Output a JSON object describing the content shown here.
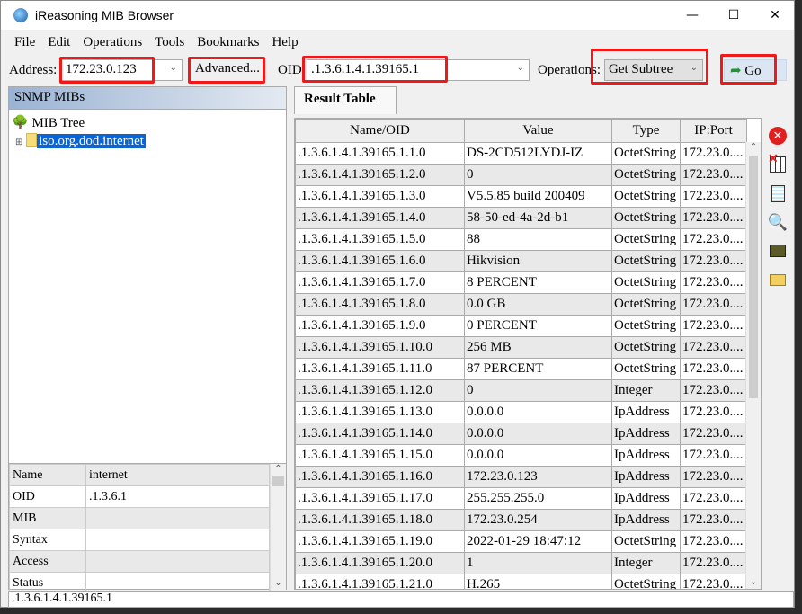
{
  "window": {
    "title": "iReasoning MIB Browser",
    "minimize": "—",
    "maximize": "☐",
    "close": "✕"
  },
  "menu": [
    "File",
    "Edit",
    "Operations",
    "Tools",
    "Bookmarks",
    "Help"
  ],
  "toolbar": {
    "address_label": "Address:",
    "address_value": "172.23.0.123",
    "advanced_label": "Advanced...",
    "oid_label": "OID:",
    "oid_value": ".1.3.6.1.4.1.39165.1",
    "operations_label": "Operations:",
    "operations_value": "Get Subtree",
    "go_label": "Go"
  },
  "left": {
    "header": "SNMP MIBs",
    "tree_root": "MIB Tree",
    "tree_node": "iso.org.dod.internet",
    "props": [
      [
        "Name",
        "internet"
      ],
      [
        "OID",
        ".1.3.6.1"
      ],
      [
        "MIB",
        ""
      ],
      [
        "Syntax",
        ""
      ],
      [
        "Access",
        ""
      ],
      [
        "Status",
        ""
      ]
    ]
  },
  "result": {
    "tab": "Result Table",
    "columns": [
      "Name/OID",
      "Value",
      "Type",
      "IP:Port"
    ],
    "rows": [
      [
        ".1.3.6.1.4.1.39165.1.1.0",
        "DS-2CD512LYDJ-IZ",
        "OctetString",
        "172.23.0...."
      ],
      [
        ".1.3.6.1.4.1.39165.1.2.0",
        "0",
        "OctetString",
        "172.23.0...."
      ],
      [
        ".1.3.6.1.4.1.39165.1.3.0",
        "V5.5.85 build 200409",
        "OctetString",
        "172.23.0...."
      ],
      [
        ".1.3.6.1.4.1.39165.1.4.0",
        "58-50-ed-4a-2d-b1",
        "OctetString",
        "172.23.0...."
      ],
      [
        ".1.3.6.1.4.1.39165.1.5.0",
        "88",
        "OctetString",
        "172.23.0...."
      ],
      [
        ".1.3.6.1.4.1.39165.1.6.0",
        "Hikvision",
        "OctetString",
        "172.23.0...."
      ],
      [
        ".1.3.6.1.4.1.39165.1.7.0",
        "8 PERCENT",
        "OctetString",
        "172.23.0...."
      ],
      [
        ".1.3.6.1.4.1.39165.1.8.0",
        "0.0 GB",
        "OctetString",
        "172.23.0...."
      ],
      [
        ".1.3.6.1.4.1.39165.1.9.0",
        "0 PERCENT",
        "OctetString",
        "172.23.0...."
      ],
      [
        ".1.3.6.1.4.1.39165.1.10.0",
        "256 MB",
        "OctetString",
        "172.23.0...."
      ],
      [
        ".1.3.6.1.4.1.39165.1.11.0",
        "87 PERCENT",
        "OctetString",
        "172.23.0...."
      ],
      [
        ".1.3.6.1.4.1.39165.1.12.0",
        "0",
        "Integer",
        "172.23.0...."
      ],
      [
        ".1.3.6.1.4.1.39165.1.13.0",
        "0.0.0.0",
        "IpAddress",
        "172.23.0...."
      ],
      [
        ".1.3.6.1.4.1.39165.1.14.0",
        "0.0.0.0",
        "IpAddress",
        "172.23.0...."
      ],
      [
        ".1.3.6.1.4.1.39165.1.15.0",
        "0.0.0.0",
        "IpAddress",
        "172.23.0...."
      ],
      [
        ".1.3.6.1.4.1.39165.1.16.0",
        "172.23.0.123",
        "IpAddress",
        "172.23.0...."
      ],
      [
        ".1.3.6.1.4.1.39165.1.17.0",
        "255.255.255.0",
        "IpAddress",
        "172.23.0...."
      ],
      [
        ".1.3.6.1.4.1.39165.1.18.0",
        "172.23.0.254",
        "IpAddress",
        "172.23.0...."
      ],
      [
        ".1.3.6.1.4.1.39165.1.19.0",
        "2022-01-29 18:47:12",
        "OctetString",
        "172.23.0...."
      ],
      [
        ".1.3.6.1.4.1.39165.1.20.0",
        "1",
        "Integer",
        "172.23.0...."
      ],
      [
        ".1.3.6.1.4.1.39165.1.21.0",
        "H.265",
        "OctetString",
        "172.23.0...."
      ]
    ]
  },
  "side_icons": [
    "stop-icon",
    "clear-table-icon",
    "document-icon",
    "find-icon",
    "export-icon",
    "open-folder-icon"
  ],
  "status": ".1.3.6.1.4.1.39165.1",
  "colors": {
    "highlight": "#f01818",
    "selection": "#0a64d4"
  }
}
